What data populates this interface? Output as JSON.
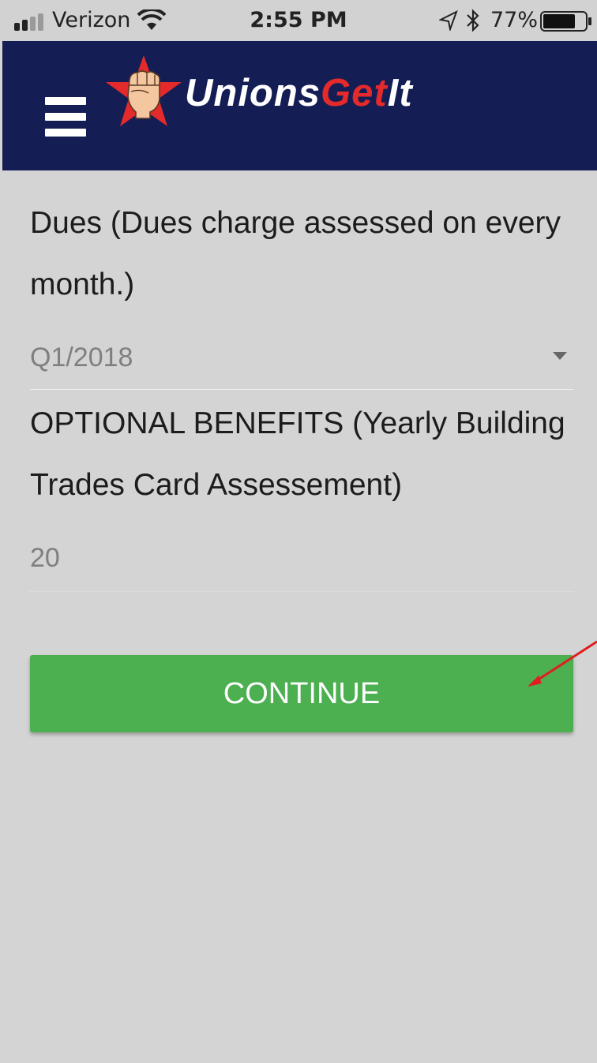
{
  "status_bar": {
    "carrier": "Verizon",
    "time": "2:55 PM",
    "battery_percent": "77%",
    "battery_level": 0.77,
    "icons": [
      "signal-icon",
      "wifi-icon",
      "location-icon",
      "bluetooth-icon",
      "battery-icon"
    ]
  },
  "header": {
    "logo_text_white_1": "Unions",
    "logo_text_red": "Get",
    "logo_text_white_2": "It",
    "bg_color": "#141e55",
    "icons": [
      "menu-icon",
      "star-fist-logo-icon"
    ]
  },
  "form": {
    "dues_label": "Dues (Dues charge assessed on every month.)",
    "dues_selected": "Q1/2018",
    "benefits_label": "OPTIONAL BENEFITS (Yearly Building Trades Card Assessement)",
    "benefits_value": "20",
    "continue_label": "CONTINUE",
    "continue_color": "#4caf50"
  },
  "annotation": {
    "arrow_color": "#e11d1d"
  }
}
